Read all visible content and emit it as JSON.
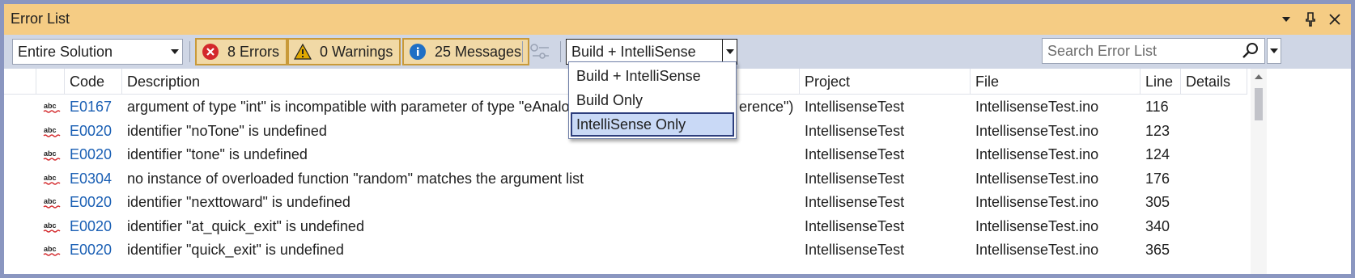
{
  "window": {
    "title": "Error List",
    "title_buttons": [
      "dropdown-arrow-icon",
      "pin-icon",
      "close-icon"
    ]
  },
  "toolbar": {
    "scope_combo": "Entire Solution",
    "errors_label": "8 Errors",
    "warnings_label": "0 Warnings",
    "messages_label": "25 Messages",
    "source_combo": "Build + IntelliSense",
    "search_placeholder": "Search Error List"
  },
  "dropdown": {
    "items": [
      "Build + IntelliSense",
      "Build Only",
      "IntelliSense Only"
    ],
    "selected": "IntelliSense Only"
  },
  "columns": {
    "code": "Code",
    "description": "Description",
    "project": "Project",
    "file": "File",
    "line": "Line",
    "details": "Details"
  },
  "rows": [
    {
      "code": "E0167",
      "description": "argument of type \"int\" is incompatible with parameter of type \"eAnalogRe",
      "description_tail": "erence\")",
      "project": "IntellisenseTest",
      "file": "IntellisenseTest.ino",
      "line": "116"
    },
    {
      "code": "E0020",
      "description": "identifier \"noTone\" is undefined",
      "description_tail": "",
      "project": "IntellisenseTest",
      "file": "IntellisenseTest.ino",
      "line": "123"
    },
    {
      "code": "E0020",
      "description": "identifier \"tone\" is undefined",
      "description_tail": "",
      "project": "IntellisenseTest",
      "file": "IntellisenseTest.ino",
      "line": "124"
    },
    {
      "code": "E0304",
      "description": "no instance of overloaded function \"random\" matches the argument list",
      "description_tail": "",
      "project": "IntellisenseTest",
      "file": "IntellisenseTest.ino",
      "line": "176"
    },
    {
      "code": "E0020",
      "description": "identifier \"nexttoward\" is undefined",
      "description_tail": "",
      "project": "IntellisenseTest",
      "file": "IntellisenseTest.ino",
      "line": "305"
    },
    {
      "code": "E0020",
      "description": "identifier \"at_quick_exit\" is undefined",
      "description_tail": "",
      "project": "IntellisenseTest",
      "file": "IntellisenseTest.ino",
      "line": "340"
    },
    {
      "code": "E0020",
      "description": "identifier \"quick_exit\" is undefined",
      "description_tail": "",
      "project": "IntellisenseTest",
      "file": "IntellisenseTest.ino",
      "line": "365"
    }
  ],
  "colors": {
    "title_bar": "#F5CC84",
    "toolbar": "#CFD6E5",
    "error_red": "#D3282B",
    "warning_yellow": "#E0A800",
    "info_blue": "#1F6FC5",
    "code_link": "#1A5FB4"
  }
}
